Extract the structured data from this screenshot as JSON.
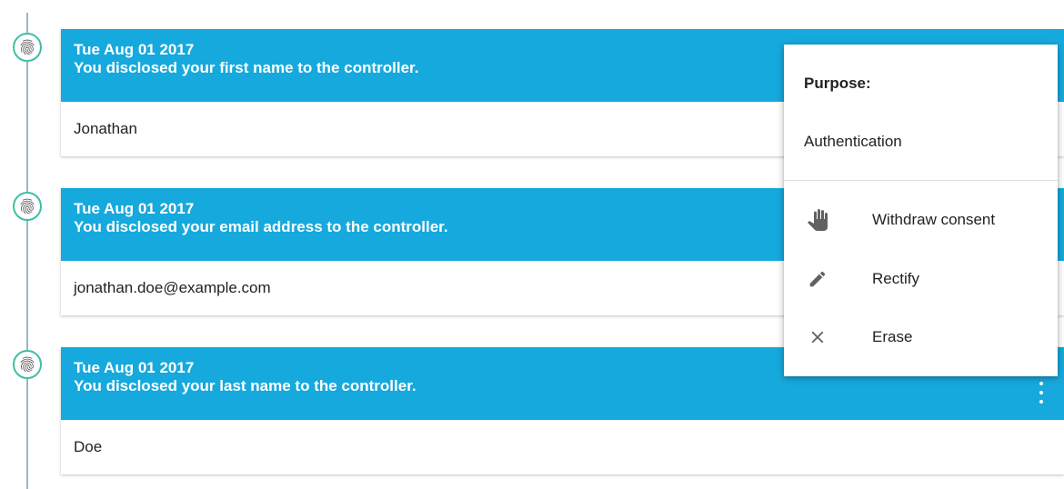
{
  "timeline": {
    "entries": [
      {
        "date": "Tue Aug 01 2017",
        "description": "You disclosed your first name to the controller.",
        "value": "Jonathan"
      },
      {
        "date": "Tue Aug 01 2017",
        "description": "You disclosed your email address to the controller.",
        "value": "jonathan.doe@example.com"
      },
      {
        "date": "Tue Aug 01 2017",
        "description": "You disclosed your last name to the controller.",
        "value": "Doe"
      }
    ]
  },
  "menu": {
    "purpose_label": "Purpose:",
    "purpose_value": "Authentication",
    "items": [
      {
        "label": "Withdraw consent",
        "icon": "hand-icon"
      },
      {
        "label": "Rectify",
        "icon": "pencil-icon"
      },
      {
        "label": "Erase",
        "icon": "close-icon"
      }
    ]
  },
  "colors": {
    "header": "#16a9dd",
    "node_border": "#3fbfa5",
    "timeline_line": "#9db4bd"
  }
}
